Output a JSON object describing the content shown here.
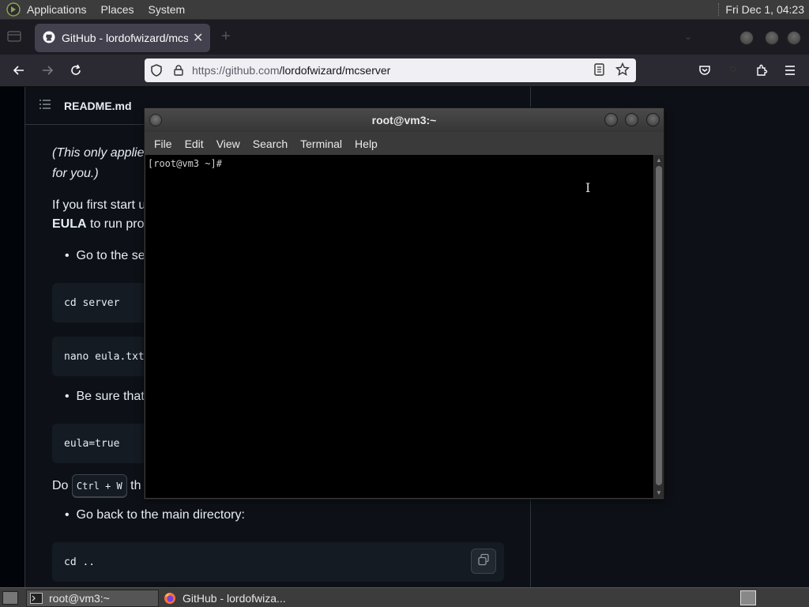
{
  "top_panel": {
    "menus": [
      "Applications",
      "Places",
      "System"
    ],
    "clock": "Fri Dec 1, 04:23"
  },
  "browser": {
    "tab_title": "GitHub - lordofwizard/mcse",
    "url_host": "https://github.com",
    "url_path": "/lordofwizard/mcserver"
  },
  "readme": {
    "filename": "README.md",
    "line1": "(This only applie",
    "line2": "for you.)",
    "line3": "If you first start u",
    "line4_bold": "EULA",
    "line4_rest": " to run pro",
    "bullet1": "Go to the se",
    "code1": "cd server",
    "code2": "nano eula.txt",
    "bullet2": "Be sure that",
    "code3": "eula=true",
    "do_text": "Do ",
    "kbd": "Ctrl + W",
    "do_rest": " th",
    "bullet3": "Go back to the main directory:",
    "code4": "cd .."
  },
  "terminal": {
    "title": "root@vm3:~",
    "menus": [
      "File",
      "Edit",
      "View",
      "Search",
      "Terminal",
      "Help"
    ],
    "prompt": "[root@vm3 ~]#"
  },
  "taskbar": {
    "task1": "root@vm3:~",
    "task2": "GitHub - lordofwiza..."
  }
}
